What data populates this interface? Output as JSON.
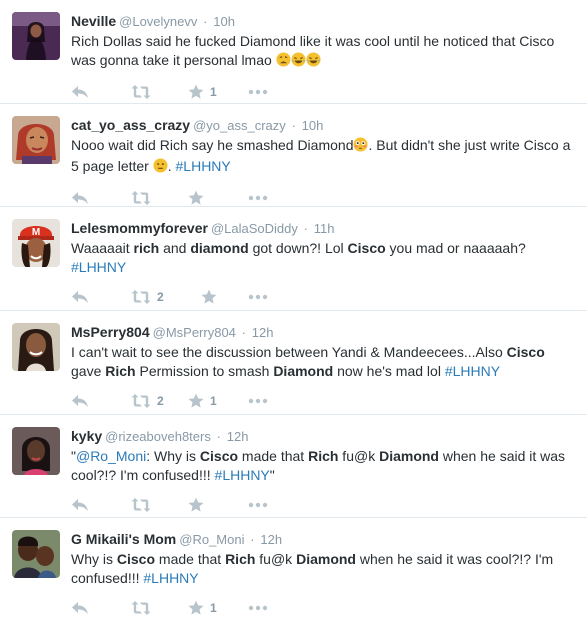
{
  "tweets": [
    {
      "name": "Neville",
      "handle": "@Lovelynevv",
      "time": "10h",
      "parts": {
        "t1": "Rich Dollas said he fucked Diamond like it was cool until he noticed that Cisco was gonna take it personal lmao "
      },
      "favorites": "1",
      "retweets": ""
    },
    {
      "name": "cat_yo_ass_crazy",
      "handle": "@yo_ass_crazy",
      "time": "10h",
      "parts": {
        "t1": "Nooo wait did Rich say he smashed Diamond",
        "t2": ". But didn't she just write Cisco a 5 page letter ",
        "t3": ". ",
        "tag": "#LHHNY"
      },
      "favorites": "",
      "retweets": ""
    },
    {
      "name": "Lelesmommyforever",
      "handle": "@LalaSoDiddy",
      "time": "11h",
      "parts": {
        "t1": "Waaaaait ",
        "b1": "rich",
        "t2": " and ",
        "b2": "diamond",
        "t3": " got down?! Lol ",
        "b3": "Cisco",
        "t4": " you mad or naaaaah?",
        "tag": "#LHHNY"
      },
      "favorites": "",
      "retweets": "2"
    },
    {
      "name": "MsPerry804",
      "handle": "@MsPerry804",
      "time": "12h",
      "parts": {
        "t1": "I can't wait to see the discussion between Yandi & Mandeecees...Also ",
        "b1": "Cisco",
        "t2": "gave ",
        "b2": "Rich",
        "t3": " Permission to smash ",
        "b3": "Diamond",
        "t4": " now he's mad lol ",
        "tag": "#LHHNY"
      },
      "favorites": "1",
      "retweets": "2"
    },
    {
      "name": "kyky",
      "handle": "@rizeaboveh8ters",
      "time": "12h",
      "parts": {
        "q1": "\"",
        "mention": "@Ro_Moni",
        "t1": ": Why is ",
        "b1": "Cisco",
        "t2": " made that ",
        "b2": "Rich",
        "t3": " fu@k ",
        "b3": "Diamond",
        "t4": " when he said it was cool?!? I'm confused!!! ",
        "tag": "#LHHNY",
        "q2": "\""
      },
      "favorites": "",
      "retweets": ""
    },
    {
      "name": "G Mikaili's Mom",
      "handle": "@Ro_Moni",
      "time": "12h",
      "parts": {
        "t1": "Why is ",
        "b1": "Cisco",
        "t2": " made that ",
        "b2": "Rich",
        "t3": " fu@k ",
        "b3": "Diamond",
        "t4": " when he said it was cool?!? I'm confused!!! ",
        "tag": "#LHHNY"
      },
      "favorites": "1",
      "retweets": ""
    }
  ],
  "separator": "·",
  "icons": {
    "reply": "reply-icon",
    "retweet": "retweet-icon",
    "favorite": "star-icon",
    "more": "more-icon",
    "emoji_laugh": "laughing-emoji",
    "emoji_weary": "weary-emoji",
    "emoji_flushed": "flushed-emoji",
    "emoji_neutral": "neutral-emoji"
  },
  "colors": {
    "link": "#2b7bb9",
    "meta": "#8899a6",
    "action_icon": "#b8c4cc",
    "divider": "#e1e8ed"
  }
}
